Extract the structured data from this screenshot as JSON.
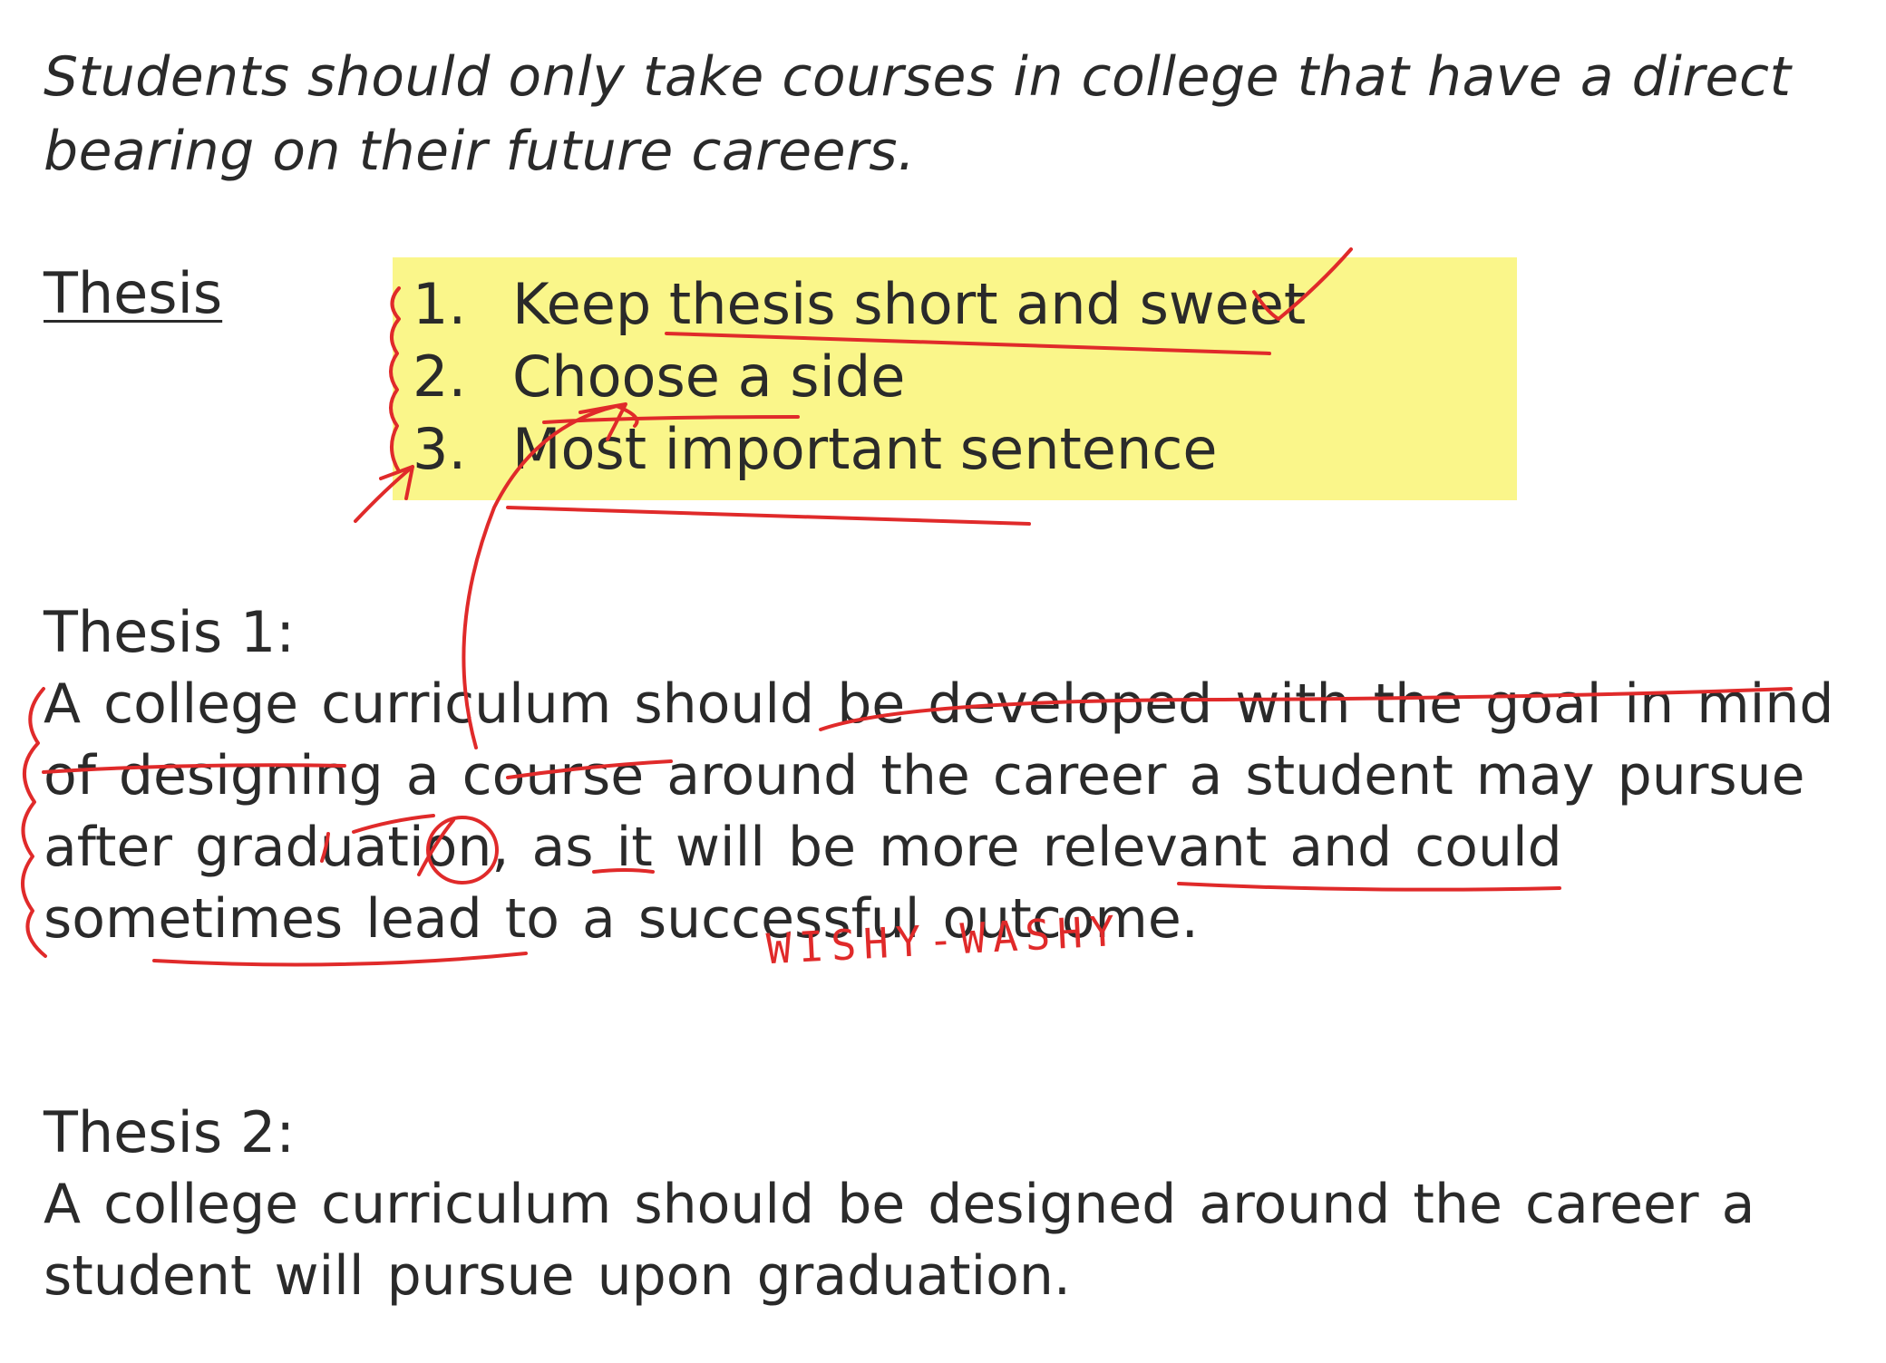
{
  "prompt": "Students should only take courses in college that have a direct bearing on their future careers.",
  "thesis_heading": "Thesis",
  "tips": [
    {
      "num": "1.",
      "text": "Keep thesis short and sweet"
    },
    {
      "num": "2.",
      "text": "Choose a side"
    },
    {
      "num": "3.",
      "text": "Most important sentence"
    }
  ],
  "thesis1": {
    "label": "Thesis 1:",
    "body": "A college curriculum should be developed with the goal in mind of designing a course around the career a student may pursue after graduation, as it will be more relevant and could sometimes lead to a successful outcome."
  },
  "thesis2": {
    "label": "Thesis 2:",
    "body": "A college curriculum should be designed around the career a student will pursue upon graduation."
  },
  "annotation": "WISHY-WASHY",
  "colors": {
    "highlight": "#faf68a",
    "ink": "#e02a2a",
    "text": "#2a2a2a"
  }
}
